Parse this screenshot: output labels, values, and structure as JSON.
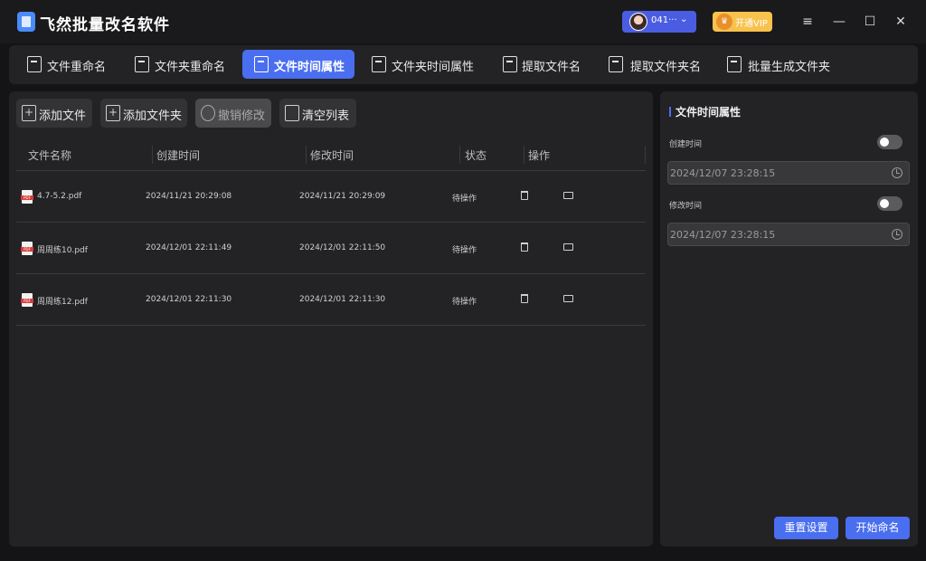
{
  "app": {
    "title": "飞然批量改名软件"
  },
  "user": {
    "name": "041···",
    "vip_label": "开通VIP"
  },
  "window_controls": {
    "menu": "≡",
    "minimize": "—",
    "maximize": "☐",
    "close": "✕"
  },
  "tabs": [
    {
      "label": "文件重命名",
      "icon": "file-rename-icon",
      "active": false
    },
    {
      "label": "文件夹重命名",
      "icon": "folder-rename-icon",
      "active": false
    },
    {
      "label": "文件时间属性",
      "icon": "file-time-icon",
      "active": true
    },
    {
      "label": "文件夹时间属性",
      "icon": "folder-time-icon",
      "active": false
    },
    {
      "label": "提取文件名",
      "icon": "extract-filename-icon",
      "active": false
    },
    {
      "label": "提取文件夹名",
      "icon": "extract-foldername-icon",
      "active": false
    },
    {
      "label": "批量生成文件夹",
      "icon": "batch-folder-icon",
      "active": false
    }
  ],
  "toolbar": {
    "add_file": "添加文件",
    "add_folder": "添加文件夹",
    "undo": "撤销修改",
    "clear": "清空列表"
  },
  "table": {
    "headers": [
      "文件名称",
      "创建时间",
      "修改时间",
      "状态",
      "操作"
    ],
    "rows": [
      {
        "name": "4.7-5.2.pdf",
        "created": "2024/11/21 20:29:08",
        "modified": "2024/11/21 20:29:09",
        "status": "待操作"
      },
      {
        "name": "周周练10.pdf",
        "created": "2024/12/01 22:11:49",
        "modified": "2024/12/01 22:11:50",
        "status": "待操作"
      },
      {
        "name": "周周练12.pdf",
        "created": "2024/12/01 22:11:30",
        "modified": "2024/12/01 22:11:30",
        "status": "待操作"
      }
    ]
  },
  "settings": {
    "title": "文件时间属性",
    "created_label": "创建时间",
    "created_value": "2024/12/07 23:28:15",
    "created_enabled": false,
    "modified_label": "修改时间",
    "modified_value": "2024/12/07 23:28:15",
    "modified_enabled": false,
    "reset_label": "重置设置",
    "start_label": "开始命名"
  },
  "colors": {
    "accent": "#4a6ef0",
    "vip": "#f8c24d",
    "background": "#141416",
    "panel": "#232326"
  }
}
